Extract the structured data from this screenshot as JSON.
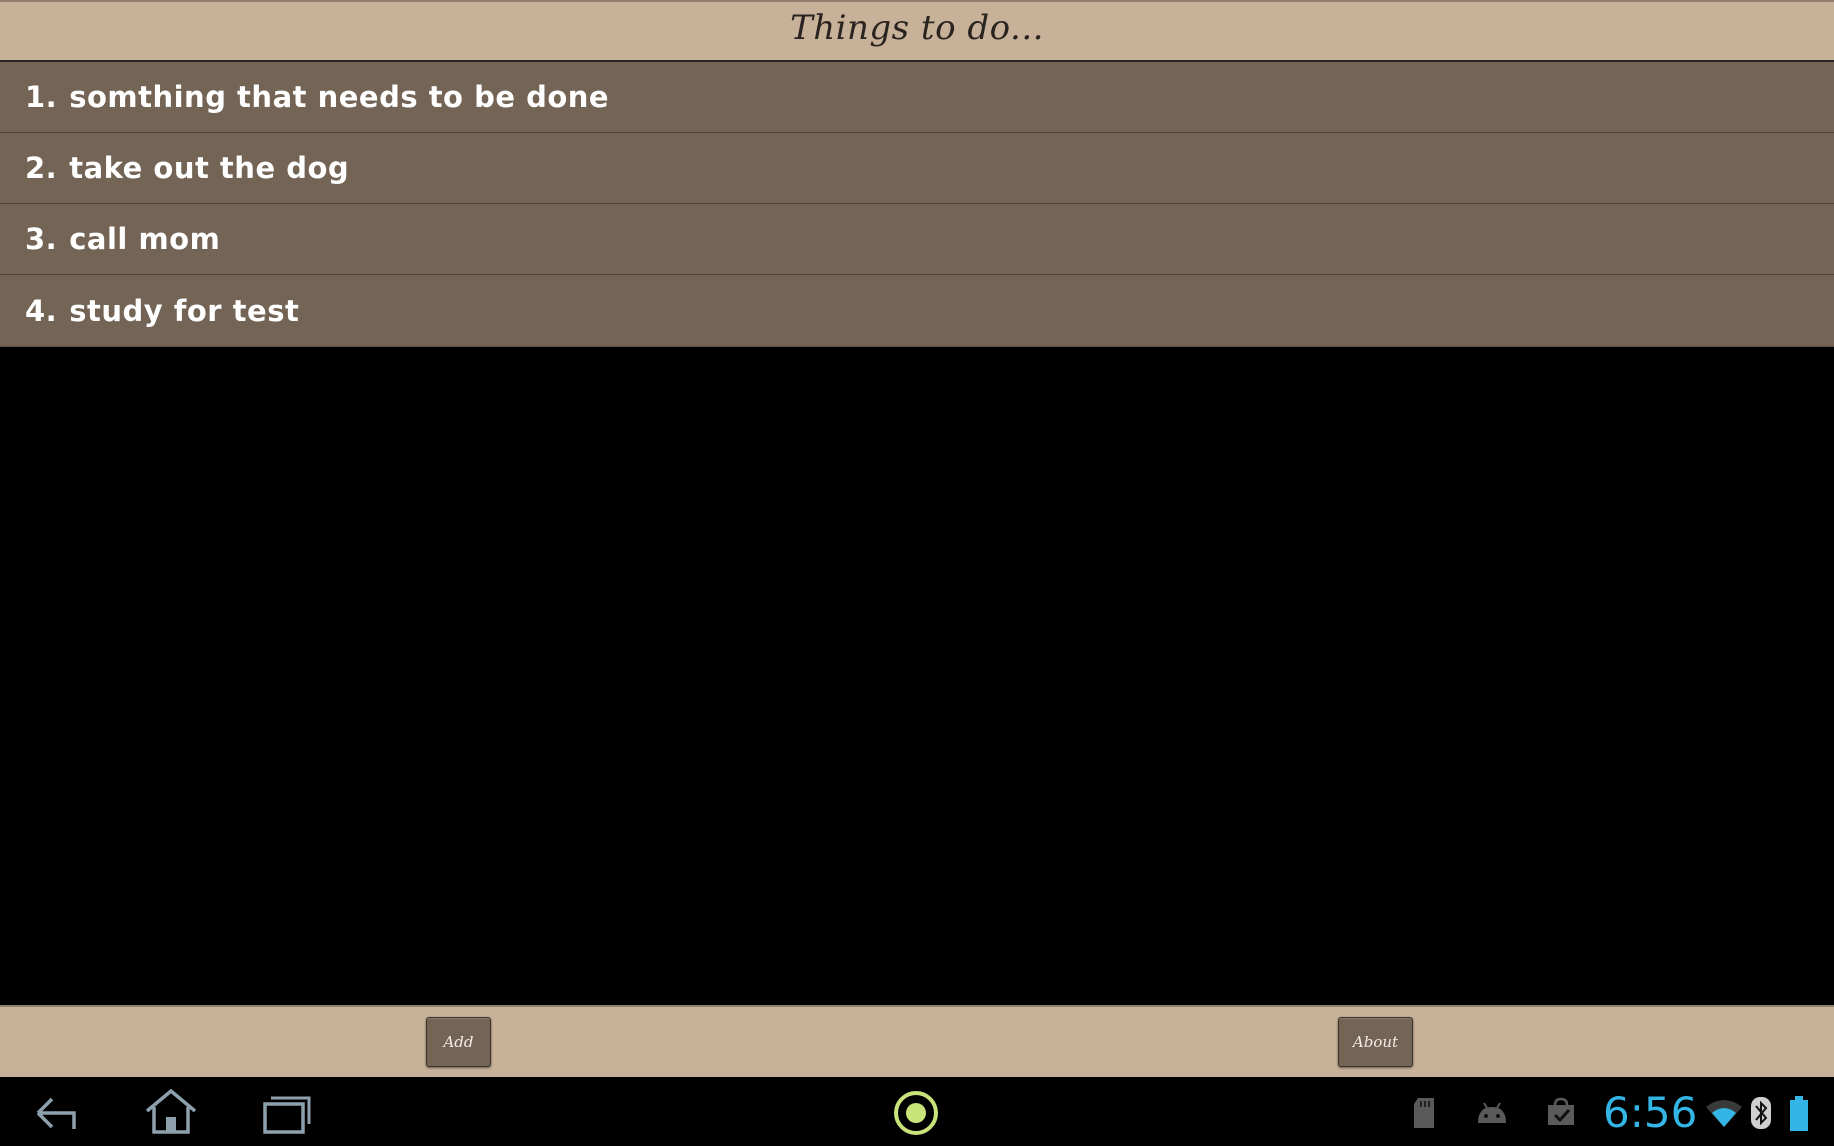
{
  "title": "Things to do...",
  "todos": [
    {
      "num": "1.",
      "text": "somthing that needs to be done"
    },
    {
      "num": "2.",
      "text": "take out the dog"
    },
    {
      "num": "3.",
      "text": "call mom"
    },
    {
      "num": "4.",
      "text": "study for test"
    }
  ],
  "buttons": {
    "add_label": "Add",
    "about_label": "About"
  },
  "system_bar": {
    "time": "6:56",
    "nav_icons": [
      "back-icon",
      "home-icon",
      "recent-apps-icon"
    ],
    "center_icon": "app-indicator-icon",
    "status_icons": [
      "sd-card-icon",
      "android-debug-icon",
      "store-icon",
      "wifi-icon",
      "bluetooth-icon",
      "battery-icon"
    ]
  },
  "colors": {
    "header_bg": "#c8b199",
    "list_bg": "#736456",
    "clock": "#33b5e5",
    "center_indicator": "#c8e37a"
  }
}
